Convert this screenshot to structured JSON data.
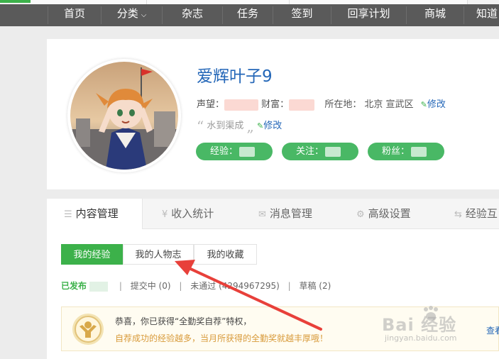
{
  "nav": {
    "items": [
      {
        "label": "首页"
      },
      {
        "label": "分类"
      },
      {
        "label": "杂志"
      },
      {
        "label": "任务"
      },
      {
        "label": "签到"
      },
      {
        "label": "回享计划"
      },
      {
        "label": "商城"
      },
      {
        "label": "知道"
      }
    ]
  },
  "profile": {
    "username": "爱辉叶子9",
    "reputation_label": "声望：",
    "wealth_label": "财富：",
    "location_label": "所在地：",
    "location_value": "北京 宣武区",
    "edit_label": "修改",
    "motto": "水到渠成",
    "motto_edit_label": "修改",
    "stats": [
      {
        "label": "经验："
      },
      {
        "label": "关注："
      },
      {
        "label": "粉丝："
      }
    ]
  },
  "tabs": [
    {
      "label": "内容管理",
      "icon": "list-icon"
    },
    {
      "label": "收入统计",
      "icon": "yen-icon"
    },
    {
      "label": "消息管理",
      "icon": "mail-icon"
    },
    {
      "label": "高级设置",
      "icon": "gear-icon"
    },
    {
      "label": "经验互",
      "icon": "swap-icon"
    }
  ],
  "subtabs": [
    {
      "label": "我的经验"
    },
    {
      "label": "我的人物志"
    },
    {
      "label": "我的收藏"
    }
  ],
  "status": {
    "published": "已发布",
    "submitting": "提交中 (0)",
    "rejected": "未通过 (4294967295)",
    "drafts": "草稿 (2)"
  },
  "notice": {
    "title": "恭喜，你已获得“全勤奖自荐”特权，",
    "subtitle": "自荐成功的经验越多，当月所获得的全勤奖就越丰厚哦！",
    "link": "查看"
  },
  "watermark": {
    "brand": "Bai  经验",
    "url": "jingyan.baidu.com"
  },
  "colors": {
    "accent_green": "#3cb14a",
    "link_blue": "#2467b8",
    "nav_bg": "#5a5a5a",
    "arrow_red": "#e8403a"
  }
}
